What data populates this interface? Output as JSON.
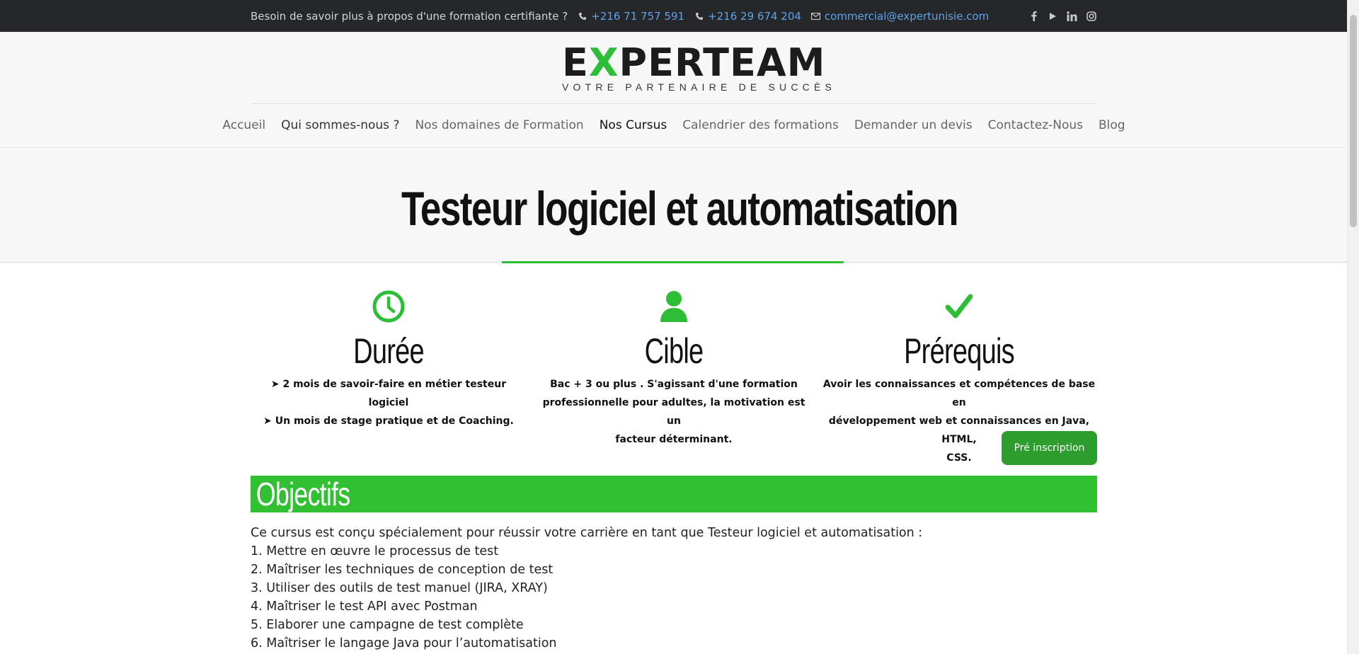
{
  "topbar": {
    "promo": "Besoin de savoir plus à propos d'une formation certifiante ?",
    "phone1": "+216 71 757 591",
    "phone2": "+216 29 674 204",
    "email": "commercial@expertunisie.com",
    "socials": [
      "facebook-icon",
      "youtube-icon",
      "linkedin-icon",
      "instagram-icon"
    ]
  },
  "logo": {
    "part1": "E",
    "x": "X",
    "part2": "PERTEAM",
    "tagline": "VOTRE PARTENAIRE DE SUCCÈS",
    "accent": "#2ebd36"
  },
  "nav": {
    "items": [
      "Accueil",
      "Qui sommes-nous ?",
      "Nos domaines de Formation",
      "Nos Cursus",
      "Calendrier des formations",
      "Demander un devis",
      "Contactez-Nous",
      "Blog"
    ],
    "active": "Nos Cursus"
  },
  "page": {
    "title": "Testeur logiciel et automatisation"
  },
  "features": [
    {
      "icon": "clock-icon",
      "title": "Durée",
      "lines": [
        "➤ 2 mois de savoir-faire en métier testeur logiciel",
        "➤ Un mois de stage pratique et de Coaching."
      ]
    },
    {
      "icon": "user-icon",
      "title": "Cible",
      "lines": [
        "Bac + 3 ou plus . S'agissant d'une formation",
        "professionnelle pour adultes, la motivation est un",
        "facteur déterminant."
      ]
    },
    {
      "icon": "checkmark-icon",
      "title": "Prérequis",
      "lines": [
        "Avoir les connaissances et compétences de base en",
        "développement web et connaissances en Java, HTML,",
        "CSS."
      ]
    }
  ],
  "cta": {
    "label": "Pré inscription"
  },
  "objectifs": {
    "heading": "Objectifs",
    "intro": "Ce cursus est conçu spécialement pour réussir votre carrière en tant que Testeur logiciel et automatisation :",
    "items": [
      "1. Mettre en œuvre le processus de test",
      "2. Maîtriser les techniques de conception de test",
      "3. Utiliser des outils de test manuel (JIRA, XRAY)",
      "4. Maîtriser le test API avec Postman",
      "5. Elaborer une campagne de test complète",
      "6. Maîtriser le langage Java pour l’automatisation"
    ]
  },
  "colors": {
    "green": "#32c033",
    "button": "#2d9e2e",
    "topbar": "#25272b",
    "link": "#5fa4e8"
  }
}
